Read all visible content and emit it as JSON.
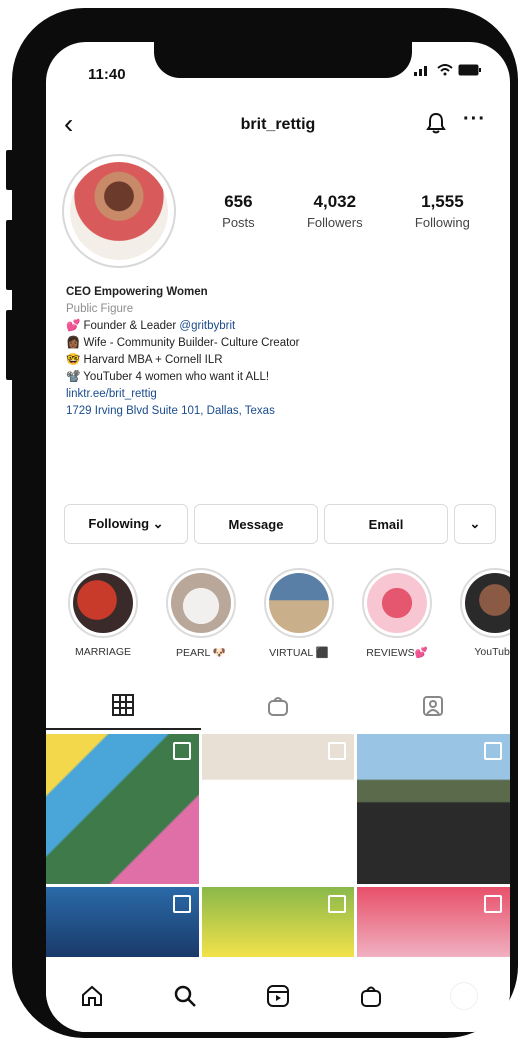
{
  "status": {
    "time": "11:40"
  },
  "header": {
    "username": "brit_rettig"
  },
  "stats": [
    {
      "value": "656",
      "label": "Posts"
    },
    {
      "value": "4,032",
      "label": "Followers"
    },
    {
      "value": "1,555",
      "label": "Following"
    }
  ],
  "bio": {
    "name": "CEO Empowering Women",
    "category": "Public Figure",
    "lines": [
      "💕 Founder & Leader",
      "👩🏾 Wife - Community Builder- Culture Creator",
      "🤓 Harvard MBA + Cornell ILR",
      "📽️ YouTuber 4 women who want it ALL!"
    ],
    "mention": "@gritbybrit",
    "link": "linktr.ee/brit_rettig",
    "address": "1729 Irving Blvd Suite 101, Dallas, Texas"
  },
  "actions": {
    "following": "Following ⌄",
    "message": "Message",
    "email": "Email",
    "more": "⌄"
  },
  "highlights": [
    {
      "label": "MARRIAGE"
    },
    {
      "label": "PEARL 🐶"
    },
    {
      "label": "VIRTUAL ⬛"
    },
    {
      "label": "REVIEWS💕"
    },
    {
      "label": "YouTube"
    }
  ],
  "colors": {
    "text": "#111111",
    "link": "#1a4b8c",
    "muted": "#8e8e8e",
    "border": "#dbdbdb"
  }
}
